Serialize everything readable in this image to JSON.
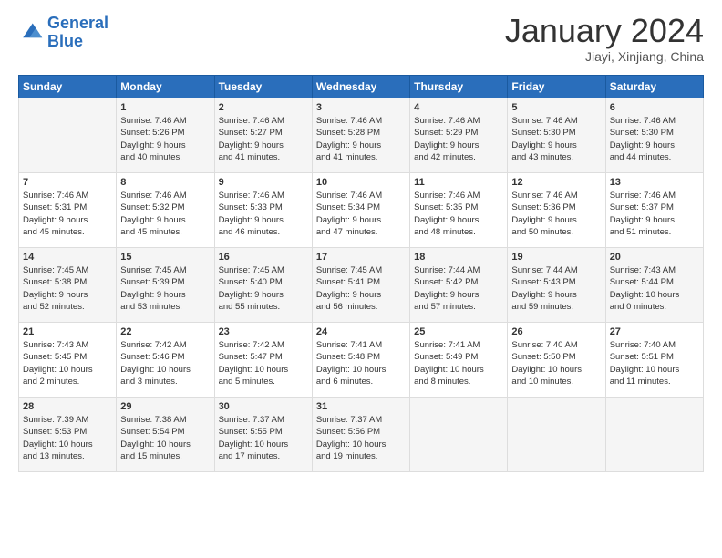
{
  "header": {
    "logo_line1": "General",
    "logo_line2": "Blue",
    "month_title": "January 2024",
    "subtitle": "Jiayi, Xinjiang, China"
  },
  "days_of_week": [
    "Sunday",
    "Monday",
    "Tuesday",
    "Wednesday",
    "Thursday",
    "Friday",
    "Saturday"
  ],
  "weeks": [
    [
      {
        "day": "",
        "info": ""
      },
      {
        "day": "1",
        "info": "Sunrise: 7:46 AM\nSunset: 5:26 PM\nDaylight: 9 hours\nand 40 minutes."
      },
      {
        "day": "2",
        "info": "Sunrise: 7:46 AM\nSunset: 5:27 PM\nDaylight: 9 hours\nand 41 minutes."
      },
      {
        "day": "3",
        "info": "Sunrise: 7:46 AM\nSunset: 5:28 PM\nDaylight: 9 hours\nand 41 minutes."
      },
      {
        "day": "4",
        "info": "Sunrise: 7:46 AM\nSunset: 5:29 PM\nDaylight: 9 hours\nand 42 minutes."
      },
      {
        "day": "5",
        "info": "Sunrise: 7:46 AM\nSunset: 5:30 PM\nDaylight: 9 hours\nand 43 minutes."
      },
      {
        "day": "6",
        "info": "Sunrise: 7:46 AM\nSunset: 5:30 PM\nDaylight: 9 hours\nand 44 minutes."
      }
    ],
    [
      {
        "day": "7",
        "info": "Sunrise: 7:46 AM\nSunset: 5:31 PM\nDaylight: 9 hours\nand 45 minutes."
      },
      {
        "day": "8",
        "info": "Sunrise: 7:46 AM\nSunset: 5:32 PM\nDaylight: 9 hours\nand 45 minutes."
      },
      {
        "day": "9",
        "info": "Sunrise: 7:46 AM\nSunset: 5:33 PM\nDaylight: 9 hours\nand 46 minutes."
      },
      {
        "day": "10",
        "info": "Sunrise: 7:46 AM\nSunset: 5:34 PM\nDaylight: 9 hours\nand 47 minutes."
      },
      {
        "day": "11",
        "info": "Sunrise: 7:46 AM\nSunset: 5:35 PM\nDaylight: 9 hours\nand 48 minutes."
      },
      {
        "day": "12",
        "info": "Sunrise: 7:46 AM\nSunset: 5:36 PM\nDaylight: 9 hours\nand 50 minutes."
      },
      {
        "day": "13",
        "info": "Sunrise: 7:46 AM\nSunset: 5:37 PM\nDaylight: 9 hours\nand 51 minutes."
      }
    ],
    [
      {
        "day": "14",
        "info": "Sunrise: 7:45 AM\nSunset: 5:38 PM\nDaylight: 9 hours\nand 52 minutes."
      },
      {
        "day": "15",
        "info": "Sunrise: 7:45 AM\nSunset: 5:39 PM\nDaylight: 9 hours\nand 53 minutes."
      },
      {
        "day": "16",
        "info": "Sunrise: 7:45 AM\nSunset: 5:40 PM\nDaylight: 9 hours\nand 55 minutes."
      },
      {
        "day": "17",
        "info": "Sunrise: 7:45 AM\nSunset: 5:41 PM\nDaylight: 9 hours\nand 56 minutes."
      },
      {
        "day": "18",
        "info": "Sunrise: 7:44 AM\nSunset: 5:42 PM\nDaylight: 9 hours\nand 57 minutes."
      },
      {
        "day": "19",
        "info": "Sunrise: 7:44 AM\nSunset: 5:43 PM\nDaylight: 9 hours\nand 59 minutes."
      },
      {
        "day": "20",
        "info": "Sunrise: 7:43 AM\nSunset: 5:44 PM\nDaylight: 10 hours\nand 0 minutes."
      }
    ],
    [
      {
        "day": "21",
        "info": "Sunrise: 7:43 AM\nSunset: 5:45 PM\nDaylight: 10 hours\nand 2 minutes."
      },
      {
        "day": "22",
        "info": "Sunrise: 7:42 AM\nSunset: 5:46 PM\nDaylight: 10 hours\nand 3 minutes."
      },
      {
        "day": "23",
        "info": "Sunrise: 7:42 AM\nSunset: 5:47 PM\nDaylight: 10 hours\nand 5 minutes."
      },
      {
        "day": "24",
        "info": "Sunrise: 7:41 AM\nSunset: 5:48 PM\nDaylight: 10 hours\nand 6 minutes."
      },
      {
        "day": "25",
        "info": "Sunrise: 7:41 AM\nSunset: 5:49 PM\nDaylight: 10 hours\nand 8 minutes."
      },
      {
        "day": "26",
        "info": "Sunrise: 7:40 AM\nSunset: 5:50 PM\nDaylight: 10 hours\nand 10 minutes."
      },
      {
        "day": "27",
        "info": "Sunrise: 7:40 AM\nSunset: 5:51 PM\nDaylight: 10 hours\nand 11 minutes."
      }
    ],
    [
      {
        "day": "28",
        "info": "Sunrise: 7:39 AM\nSunset: 5:53 PM\nDaylight: 10 hours\nand 13 minutes."
      },
      {
        "day": "29",
        "info": "Sunrise: 7:38 AM\nSunset: 5:54 PM\nDaylight: 10 hours\nand 15 minutes."
      },
      {
        "day": "30",
        "info": "Sunrise: 7:37 AM\nSunset: 5:55 PM\nDaylight: 10 hours\nand 17 minutes."
      },
      {
        "day": "31",
        "info": "Sunrise: 7:37 AM\nSunset: 5:56 PM\nDaylight: 10 hours\nand 19 minutes."
      },
      {
        "day": "",
        "info": ""
      },
      {
        "day": "",
        "info": ""
      },
      {
        "day": "",
        "info": ""
      }
    ]
  ]
}
